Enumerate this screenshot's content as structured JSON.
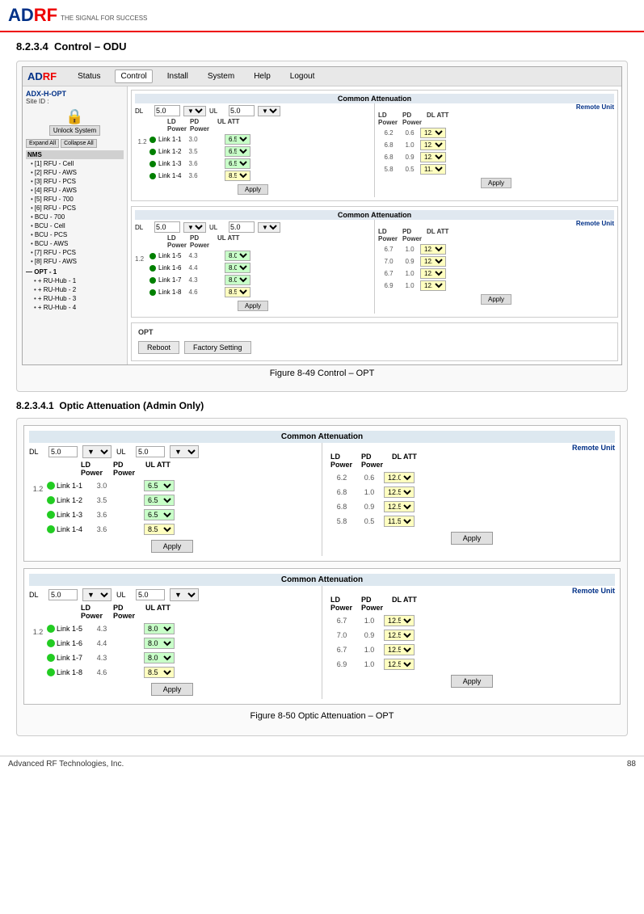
{
  "header": {
    "logo": "ADRF",
    "logo_suffix": "THE SIGNAL FOR SUCCESS",
    "tagline": "THE SIGNAL FOR SUCCESS"
  },
  "section1": {
    "number": "8.2.3.4",
    "title": "Control – ODU"
  },
  "figure49": {
    "caption": "Figure 8-49   Control – OPT"
  },
  "section2": {
    "number": "8.2.3.4.1",
    "title": "Optic Attenuation (Admin Only)"
  },
  "figure50": {
    "caption": "Figure 8-50   Optic Attenuation – OPT"
  },
  "nav": {
    "logo": "ADRF",
    "items": [
      "Status",
      "Control",
      "Install",
      "System",
      "Help",
      "Logout"
    ],
    "active": "Control"
  },
  "sidebar": {
    "device": "ADX-H-OPT",
    "site_label": "Site ID :",
    "unlock_btn": "Unlock System",
    "expand_btn": "Expand All",
    "collapse_btn": "Collapse All",
    "nms": "NMS",
    "tree": [
      "[1] RFU - Cell",
      "[2] RFU - AWS",
      "[3] RFU - PCS",
      "[4] RFU - AWS",
      "[5] RFU - 700",
      "[6] RFU - PCS",
      "BCU - 700",
      "BCU - Cell",
      "BCU - PCS",
      "BCU - AWS",
      "[7] RFU - PCS",
      "[8] RFU - AWS"
    ],
    "opt_section": "OPT - 1",
    "opt_items": [
      "RU-Hub - 1",
      "RU-Hub - 2",
      "RU-Hub - 3",
      "RU-Hub - 4"
    ]
  },
  "panel1": {
    "common_att": "Common Attenuation",
    "dl_label": "DL",
    "ul_label": "UL",
    "dl_value": "5.0",
    "ul_value": "5.0",
    "local_headers": [
      "LD Power",
      "PD Power",
      "UL ATT"
    ],
    "remote_label": "Remote Unit",
    "remote_headers": [
      "LD Power",
      "PD Power",
      "DL ATT"
    ],
    "group_label": "1.2",
    "links": [
      {
        "name": "Link 1-1",
        "ld": "3.0",
        "pd": "",
        "ul_att": "6.5",
        "r_ld": "6.2",
        "r_pd": "0.6",
        "dl_att": "12.0"
      },
      {
        "name": "Link 1-2",
        "ld": "3.5",
        "pd": "",
        "ul_att": "6.5",
        "r_ld": "6.8",
        "r_pd": "1.0",
        "dl_att": "12.5"
      },
      {
        "name": "Link 1-3",
        "ld": "3.6",
        "pd": "",
        "ul_att": "6.5",
        "r_ld": "6.8",
        "r_pd": "0.9",
        "dl_att": "12.5"
      },
      {
        "name": "Link 1-4",
        "ld": "3.6",
        "pd": "",
        "ul_att": "8.5",
        "r_ld": "5.8",
        "r_pd": "0.5",
        "dl_att": "11.5"
      }
    ],
    "apply_btn": "Apply",
    "apply_btn_remote": "Apply"
  },
  "panel2": {
    "common_att": "Common Attenuation",
    "dl_label": "DL",
    "ul_label": "UL",
    "dl_value": "5.0",
    "ul_value": "5.0",
    "local_headers": [
      "LD Power",
      "PD Power",
      "UL ATT"
    ],
    "remote_label": "Remote Unit",
    "remote_headers": [
      "LD Power",
      "PD Power",
      "DL ATT"
    ],
    "group_label": "1.2",
    "links": [
      {
        "name": "Link 1-5",
        "ld": "4.3",
        "pd": "",
        "ul_att": "8.0",
        "r_ld": "6.7",
        "r_pd": "1.0",
        "dl_att": "12.5"
      },
      {
        "name": "Link 1-6",
        "ld": "4.4",
        "pd": "",
        "ul_att": "8.0",
        "r_ld": "7.0",
        "r_pd": "0.9",
        "dl_att": "12.5"
      },
      {
        "name": "Link 1-7",
        "ld": "4.3",
        "pd": "",
        "ul_att": "8.0",
        "r_ld": "6.7",
        "r_pd": "1.0",
        "dl_att": "12.5"
      },
      {
        "name": "Link 1-8",
        "ld": "4.6",
        "pd": "",
        "ul_att": "8.5",
        "r_ld": "6.9",
        "r_pd": "1.0",
        "dl_att": "12.5"
      }
    ],
    "apply_btn": "Apply",
    "apply_btn_remote": "Apply"
  },
  "opt_section": {
    "label": "OPT",
    "reboot_btn": "Reboot",
    "factory_btn": "Factory Setting"
  },
  "big_panel1": {
    "common_att": "Common Attenuation",
    "dl_label": "DL",
    "ul_label": "UL",
    "dl_value": "5.0",
    "ul_value": "5.0",
    "local_headers": [
      "LD Power",
      "PD Power",
      "UL ATT"
    ],
    "remote_label": "Remote Unit",
    "remote_headers": [
      "LD Power",
      "PD Power",
      "DL ATT"
    ],
    "group_label": "1.2",
    "links": [
      {
        "name": "Link 1-1",
        "ld": "3.0",
        "ul_att": "6.5",
        "ul_color": "green",
        "r_ld": "6.2",
        "r_pd": "0.6",
        "dl_att": "12.0",
        "dl_color": "yellow"
      },
      {
        "name": "Link 1-2",
        "ld": "3.5",
        "ul_att": "6.5",
        "ul_color": "green",
        "r_ld": "6.8",
        "r_pd": "1.0",
        "dl_att": "12.5",
        "dl_color": "yellow"
      },
      {
        "name": "Link 1-3",
        "ld": "3.6",
        "ul_att": "6.5",
        "ul_color": "green",
        "r_ld": "6.8",
        "r_pd": "0.9",
        "dl_att": "12.5",
        "dl_color": "yellow"
      },
      {
        "name": "Link 1-4",
        "ld": "3.6",
        "ul_att": "8.5",
        "ul_color": "yellow",
        "r_ld": "5.8",
        "r_pd": "0.5",
        "dl_att": "11.5",
        "dl_color": "yellow"
      }
    ],
    "apply_btn": "Apply",
    "apply_btn_remote": "Apply"
  },
  "big_panel2": {
    "common_att": "Common Attenuation",
    "dl_label": "DL",
    "ul_label": "UL",
    "dl_value": "5.0",
    "ul_value": "5.0",
    "local_headers": [
      "LD Power",
      "PD Power",
      "UL ATT"
    ],
    "remote_label": "Remote Unit",
    "remote_headers": [
      "LD Power",
      "PD Power",
      "DL ATT"
    ],
    "group_label": "1.2",
    "links": [
      {
        "name": "Link 1-5",
        "ld": "4.3",
        "ul_att": "8.0",
        "ul_color": "green",
        "r_ld": "6.7",
        "r_pd": "1.0",
        "dl_att": "12.5",
        "dl_color": "yellow"
      },
      {
        "name": "Link 1-6",
        "ld": "4.4",
        "ul_att": "8.0",
        "ul_color": "green",
        "r_ld": "7.0",
        "r_pd": "0.9",
        "dl_att": "12.5",
        "dl_color": "yellow"
      },
      {
        "name": "Link 1-7",
        "ld": "4.3",
        "ul_att": "8.0",
        "ul_color": "green",
        "r_ld": "6.7",
        "r_pd": "1.0",
        "dl_att": "12.5",
        "dl_color": "yellow"
      },
      {
        "name": "Link 1-8",
        "ld": "4.6",
        "ul_att": "8.5",
        "ul_color": "yellow",
        "r_ld": "6.9",
        "r_pd": "1.0",
        "dl_att": "12.5",
        "dl_color": "yellow"
      }
    ],
    "apply_btn": "Apply",
    "apply_btn_remote": "Apply"
  },
  "footer": {
    "company": "Advanced RF Technologies, Inc.",
    "page": "88"
  }
}
